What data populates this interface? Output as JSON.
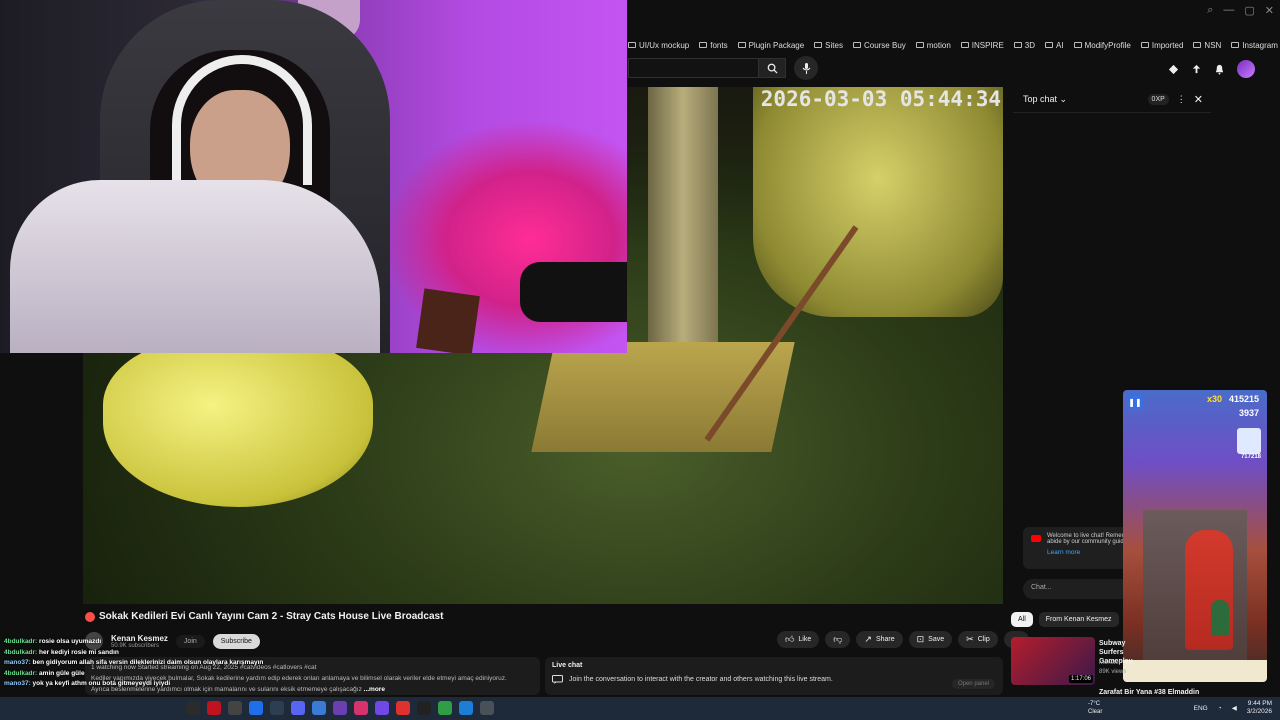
{
  "bookmarks": [
    "UI/Ux mockup",
    "fonts",
    "Plugin Package",
    "Sites",
    "Course Buy",
    "motion",
    "INSPIRE",
    "3D",
    "AI",
    "ModifyProfile",
    "Imported",
    "NSN",
    "Instagram and Tik..."
  ],
  "video": {
    "timestamp": "2026-03-03 05:44:34"
  },
  "title": "Sokak Kedileri Evi Canlı Yayını Cam 2 - Stray Cats House Live Broadcast",
  "channel": {
    "name": "Kenan Kesmez",
    "subs": "50.9K subscribers",
    "join": "Join",
    "subscribe": "Subscribe"
  },
  "actions": {
    "like": "Like",
    "share": "Share",
    "save": "Save",
    "clip": "Clip"
  },
  "description": {
    "line1": "1 watching now  Started streaming on Aug 22, 2025  #catvideos #catlovers #cat",
    "line2": "Kediler yapımızda yiyecek bulmalar, Sokak kedilerine yardım edip ederek onları anlamaya ve bilimsel olarak veriler elde etmeyi amaç ediniyoruz.",
    "line3": "Ayrıca beslenmelerine yardımcı olmak için mamalarını ve sularını eksik etmemeye çalışacağız",
    "more": "...more"
  },
  "livechat_box": {
    "title": "Live chat",
    "subtitle": "Join the conversation to interact with the creator and others watching this live stream.",
    "open": "Open panel"
  },
  "chat": {
    "mode": "Top chat",
    "xp": "0XP",
    "welcome": "Welcome to live chat! Remember to guard your privacy and abide by our community guidelines.",
    "learn": "Learn more",
    "placeholder": "Chat..."
  },
  "chips": [
    "All",
    "From Kenan Kesmez"
  ],
  "related": {
    "title": "Subway Surfers Gameplay",
    "channel": "Monster",
    "views": "89K views",
    "duration": "1:17:06",
    "next": "Zarafat Bir Yana #38 Elmaddin"
  },
  "game": {
    "multiplier": "x30",
    "score": "415215",
    "coins": "3937",
    "highscore": "717218"
  },
  "twitch_chat": [
    {
      "user": "4bdulkadr:",
      "msg": "rosie olsa uyumazdı"
    },
    {
      "user": "4bdulkadr:",
      "msg": "her kediyi rosie mi sandın"
    },
    {
      "user": "mano37:",
      "msg": "ben gidiyorum allah sifa versin dileklerinizi daim olsun olaylara karışmayın"
    },
    {
      "user": "4bdulkadr:",
      "msg": "amin güle güle"
    },
    {
      "user": "mano37:",
      "msg": "yok ya keyfi athm onu bota gitmeyeydi iyiydi"
    }
  ],
  "taskbar": {
    "weather_temp": "-7°C",
    "weather_desc": "Clear",
    "lang": "ENG",
    "time": "9:44 PM",
    "date": "3/2/2026"
  },
  "colors": {
    "background": "#0f0f0f",
    "live_red": "#ff4e45",
    "link_blue": "#3ea6ff",
    "taskbar": "#1e2a3a"
  }
}
